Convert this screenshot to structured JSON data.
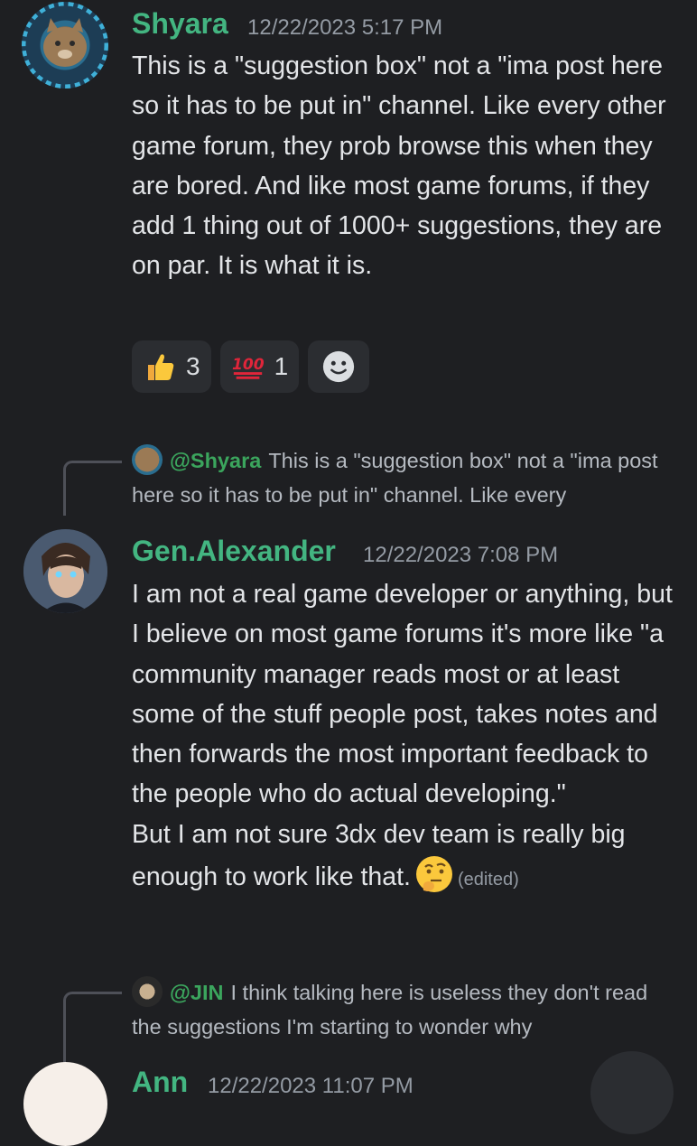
{
  "messages": [
    {
      "username": "Shyara",
      "username_color": "#43b581",
      "timestamp": "12/22/2023 5:17 PM",
      "text": "This is a \"suggestion box\" not a \"ima post here so it has to be put in\" channel. Like every other game forum, they prob browse this when they are bored. And like most game forums, if they add 1 thing out of 1000+ suggestions, they are on par. It is what it is.",
      "reactions": [
        {
          "icon": "thumbs-up-icon",
          "count": "3"
        },
        {
          "icon": "hundred-points-icon",
          "count": "1"
        }
      ]
    },
    {
      "reply": {
        "mention": "@Shyara",
        "preview": "This is a \"suggestion box\" not a \"ima post here so it has to be put in\" channel. Like every"
      },
      "username": "Gen.Alexander",
      "username_color": "#43b581",
      "timestamp": "12/22/2023 7:08 PM",
      "text_lines": [
        "I am not a real game developer or anything, but I believe on most game forums it's more like \"a community manager reads most or at least some of the stuff people post, takes notes and then forwards the most important feedback to the people who do actual developing.\"",
        "But I am not sure 3dx dev team is really big enough to work like that."
      ],
      "inline_emoji": "thinking-face-icon",
      "edited_label": "(edited)"
    },
    {
      "reply": {
        "mention": "@JIN",
        "preview": "I think talking here is useless they don't read the suggestions I'm starting to wonder why"
      },
      "username": "Ann",
      "timestamp": "12/22/2023 11:07 PM"
    }
  ]
}
